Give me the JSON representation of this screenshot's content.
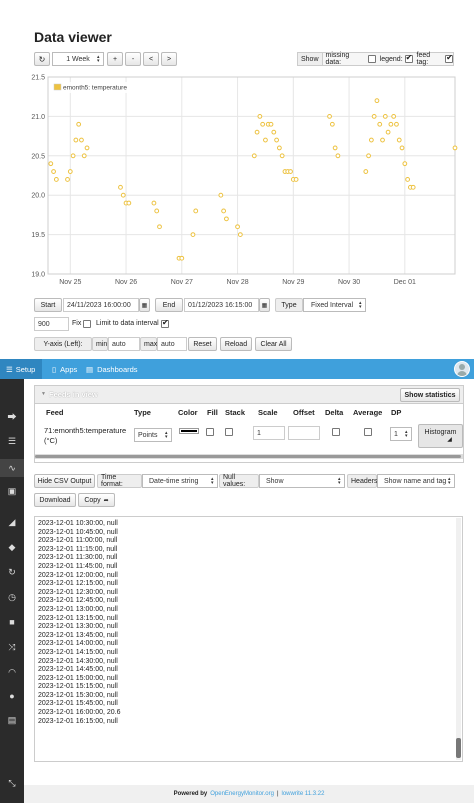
{
  "page": {
    "title": "Data viewer"
  },
  "toolbar": {
    "refresh_icon": "refresh-icon",
    "range_select": "1 Week",
    "zoom_in": "+",
    "zoom_out": "-",
    "prev": "<",
    "next": ">",
    "show_label": "Show",
    "missing_label": "missing data:",
    "missing_checked": false,
    "legend_label": "legend:",
    "legend_checked": true,
    "feed_tag_label": "feed tag:",
    "feed_tag_checked": true
  },
  "chart_data": {
    "type": "scatter",
    "ylim": [
      19.0,
      21.5
    ],
    "yticks": [
      "21.5",
      "21.0",
      "20.5",
      "20.0",
      "19.5",
      "19.0"
    ],
    "xticks": [
      "Nov 25",
      "Nov 26",
      "Nov 27",
      "Nov 28",
      "Nov 29",
      "Nov 30",
      "Dec 01"
    ],
    "xrange_days": [
      0,
      7.3
    ],
    "xtick_days": [
      0.4,
      1.4,
      2.4,
      3.4,
      4.4,
      5.4,
      6.4
    ],
    "legend": "emonth5: temperature",
    "point_color": "#edc240",
    "series": [
      {
        "name": "emonth5: temperature",
        "points": [
          [
            0.05,
            20.4
          ],
          [
            0.1,
            20.3
          ],
          [
            0.15,
            20.2
          ],
          [
            0.35,
            20.2
          ],
          [
            0.4,
            20.3
          ],
          [
            0.45,
            20.5
          ],
          [
            0.5,
            20.7
          ],
          [
            0.55,
            20.9
          ],
          [
            0.6,
            20.7
          ],
          [
            0.65,
            20.5
          ],
          [
            0.7,
            20.6
          ],
          [
            1.3,
            20.1
          ],
          [
            1.35,
            20.0
          ],
          [
            1.4,
            19.9
          ],
          [
            1.45,
            19.9
          ],
          [
            1.9,
            19.9
          ],
          [
            1.95,
            19.8
          ],
          [
            2.0,
            19.6
          ],
          [
            2.35,
            19.2
          ],
          [
            2.4,
            19.2
          ],
          [
            2.6,
            19.5
          ],
          [
            2.65,
            19.8
          ],
          [
            3.1,
            20.0
          ],
          [
            3.15,
            19.8
          ],
          [
            3.2,
            19.7
          ],
          [
            3.4,
            19.6
          ],
          [
            3.45,
            19.5
          ],
          [
            3.7,
            20.5
          ],
          [
            3.75,
            20.8
          ],
          [
            3.8,
            21.0
          ],
          [
            3.85,
            20.9
          ],
          [
            3.9,
            20.7
          ],
          [
            3.95,
            20.9
          ],
          [
            4.0,
            20.9
          ],
          [
            4.05,
            20.8
          ],
          [
            4.1,
            20.7
          ],
          [
            4.15,
            20.6
          ],
          [
            4.2,
            20.5
          ],
          [
            4.25,
            20.3
          ],
          [
            4.3,
            20.3
          ],
          [
            4.35,
            20.3
          ],
          [
            4.4,
            20.2
          ],
          [
            4.45,
            20.2
          ],
          [
            5.05,
            21.0
          ],
          [
            5.1,
            20.9
          ],
          [
            5.15,
            20.6
          ],
          [
            5.2,
            20.5
          ],
          [
            5.7,
            20.3
          ],
          [
            5.75,
            20.5
          ],
          [
            5.8,
            20.7
          ],
          [
            5.85,
            21.0
          ],
          [
            5.9,
            21.2
          ],
          [
            5.95,
            20.9
          ],
          [
            6.0,
            20.7
          ],
          [
            6.05,
            21.0
          ],
          [
            6.1,
            20.8
          ],
          [
            6.15,
            20.9
          ],
          [
            6.2,
            21.0
          ],
          [
            6.25,
            20.9
          ],
          [
            6.3,
            20.7
          ],
          [
            6.35,
            20.6
          ],
          [
            6.4,
            20.4
          ],
          [
            6.45,
            20.2
          ],
          [
            6.5,
            20.1
          ],
          [
            6.55,
            20.1
          ],
          [
            7.3,
            20.6
          ]
        ]
      }
    ]
  },
  "range_controls": {
    "start_label": "Start",
    "start_value": "24/11/2023 16:00:00",
    "end_label": "End",
    "end_value": "01/12/2023 16:15:00",
    "type_label": "Type",
    "type_value": "Fixed Interval",
    "interval_value": "900",
    "fix_label": "Fix",
    "fix_checked": false,
    "limit_label": "Limit to data interval",
    "limit_checked": true,
    "yaxis_label": "Y-axis (Left):",
    "min_label": "min",
    "min_value": "auto",
    "max_label": "max",
    "max_value": "auto",
    "reset": "Reset",
    "reload": "Reload",
    "clear_all": "Clear All"
  },
  "navbar": {
    "setup": "Setup",
    "apps": "Apps",
    "dashboards": "Dashboards",
    "bg_color": "#3fa0dc"
  },
  "feeds_panel": {
    "title": "Feeds in view",
    "show_statistics": "Show statistics",
    "headers": [
      "Feed",
      "Type",
      "Color",
      "Fill",
      "Stack",
      "Scale",
      "Offset",
      "Delta",
      "Average",
      "DP"
    ],
    "row": {
      "feed": "71:emonth5:temperature (°C)",
      "type": "Points",
      "color": "#000000",
      "scale": "1",
      "offset": "",
      "dp": "1",
      "histogram": "Histogram"
    }
  },
  "csv": {
    "hide_csv": "Hide CSV Output",
    "time_format_label": "Time format:",
    "time_format_value": "Date-time string",
    "null_values_label": "Null values:",
    "null_values_value": "Show",
    "headers_label": "Headers:",
    "headers_value": "Show name and tag",
    "download": "Download",
    "copy": "Copy",
    "lines": [
      "2023-12-01 10:30:00, null",
      "2023-12-01 10:45:00, null",
      "2023-12-01 11:00:00, null",
      "2023-12-01 11:15:00, null",
      "2023-12-01 11:30:00, null",
      "2023-12-01 11:45:00, null",
      "2023-12-01 12:00:00, null",
      "2023-12-01 12:15:00, null",
      "2023-12-01 12:30:00, null",
      "2023-12-01 12:45:00, null",
      "2023-12-01 13:00:00, null",
      "2023-12-01 13:15:00, null",
      "2023-12-01 13:30:00, null",
      "2023-12-01 13:45:00, null",
      "2023-12-01 14:00:00, null",
      "2023-12-01 14:15:00, null",
      "2023-12-01 14:30:00, null",
      "2023-12-01 14:45:00, null",
      "2023-12-01 15:00:00, null",
      "2023-12-01 15:15:00, null",
      "2023-12-01 15:30:00, null",
      "2023-12-01 15:45:00, null",
      "2023-12-01 16:00:00, 20.6",
      "2023-12-01 16:15:00, null"
    ]
  },
  "footer": {
    "powered_by": "Powered by",
    "oem_link": "OpenEnergyMonitor.org",
    "separator": "|",
    "version": "lowwrite 11.3.22"
  }
}
